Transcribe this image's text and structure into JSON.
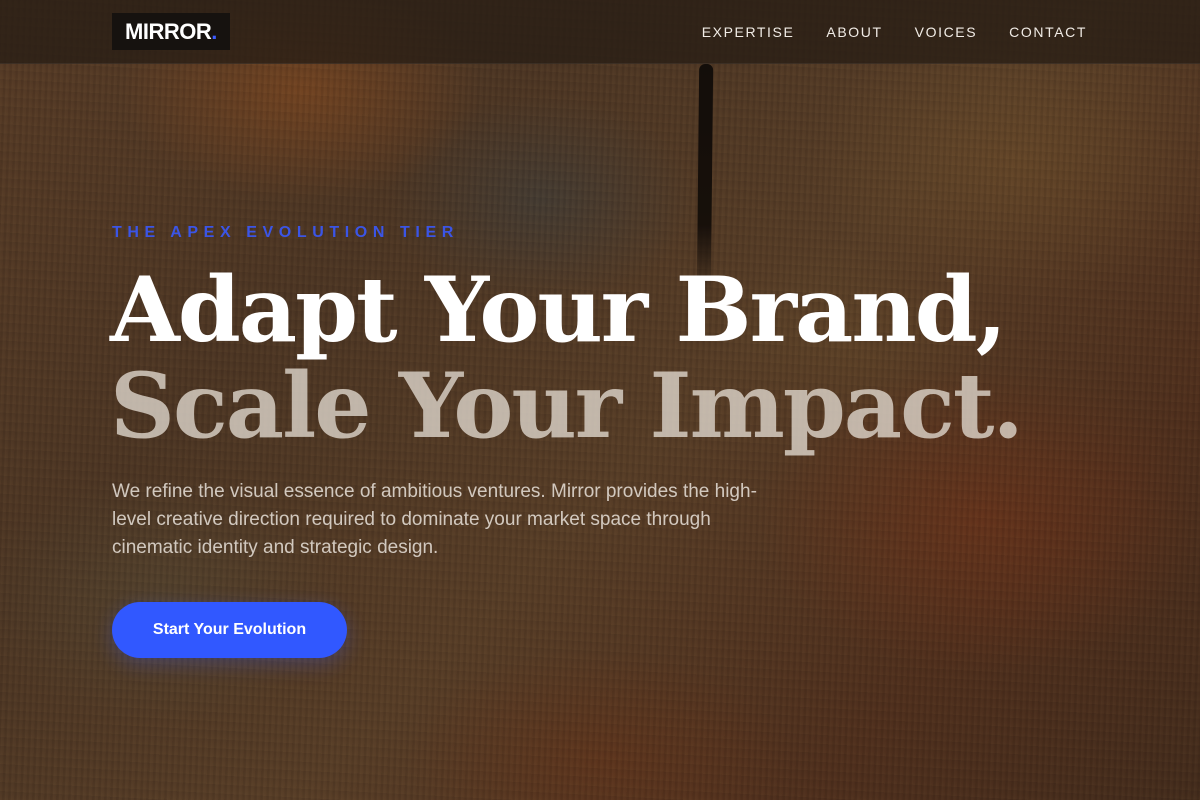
{
  "nav": {
    "logo_text": "MIRROR",
    "logo_dot": ".",
    "links": [
      "EXPERTISE",
      "ABOUT",
      "VOICES",
      "CONTACT"
    ]
  },
  "hero": {
    "eyebrow": "THE APEX EVOLUTION TIER",
    "headline_line1": "Adapt Your Brand,",
    "headline_line2": "Scale Your Impact.",
    "description": "We refine the visual essence of ambitious ventures. Mirror provides the high-level creative direction required to dominate your market space through cinematic identity and strategic design.",
    "cta_label": "Start Your Evolution"
  },
  "colors": {
    "accent": "#3158ff",
    "eyebrow": "#3b55e6",
    "nav_background": "#281e14",
    "logo_background": "#16120f"
  }
}
